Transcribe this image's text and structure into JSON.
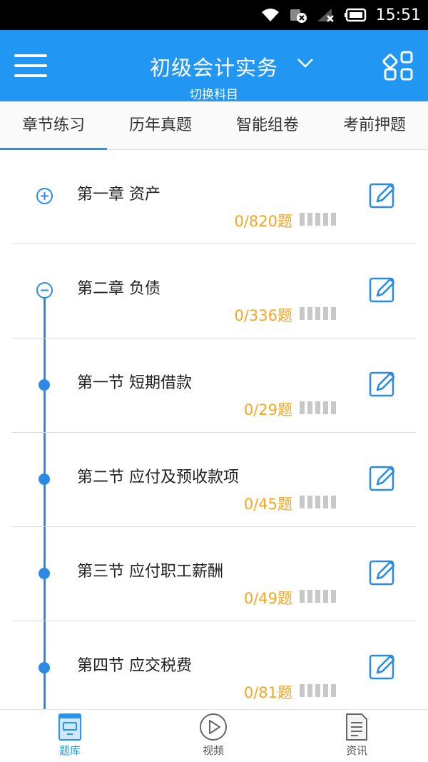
{
  "status_bar": {
    "time": "15:51"
  },
  "header": {
    "title": "初级会计实务",
    "subtitle": "切换科目",
    "accent": "#2196f3"
  },
  "tabs": [
    {
      "label": "章节练习",
      "active": true
    },
    {
      "label": "历年真题",
      "active": false
    },
    {
      "label": "智能组卷",
      "active": false
    },
    {
      "label": "考前押题",
      "active": false
    }
  ],
  "chapters": [
    {
      "title": "第一章 资产",
      "count": "0/820题",
      "marker": "expand-plus-icon"
    },
    {
      "title": "第二章 负债",
      "count": "0/336题",
      "marker": "collapse-minus-icon"
    },
    {
      "title": "第一节 短期借款",
      "count": "0/29题",
      "marker": "timeline-dot"
    },
    {
      "title": "第二节 应付及预收款项",
      "count": "0/45题",
      "marker": "timeline-dot"
    },
    {
      "title": "第三节 应付职工薪酬",
      "count": "0/49题",
      "marker": "timeline-dot"
    },
    {
      "title": "第四节 应交税费",
      "count": "0/81题",
      "marker": "timeline-dot"
    }
  ],
  "bottom_nav": [
    {
      "label": "题库",
      "icon": "question-bank-icon",
      "active": true
    },
    {
      "label": "视频",
      "icon": "video-play-icon",
      "active": false
    },
    {
      "label": "资讯",
      "icon": "news-document-icon",
      "active": false
    }
  ],
  "colors": {
    "count": "#f5a623",
    "timeline": "#2a8ae6"
  }
}
